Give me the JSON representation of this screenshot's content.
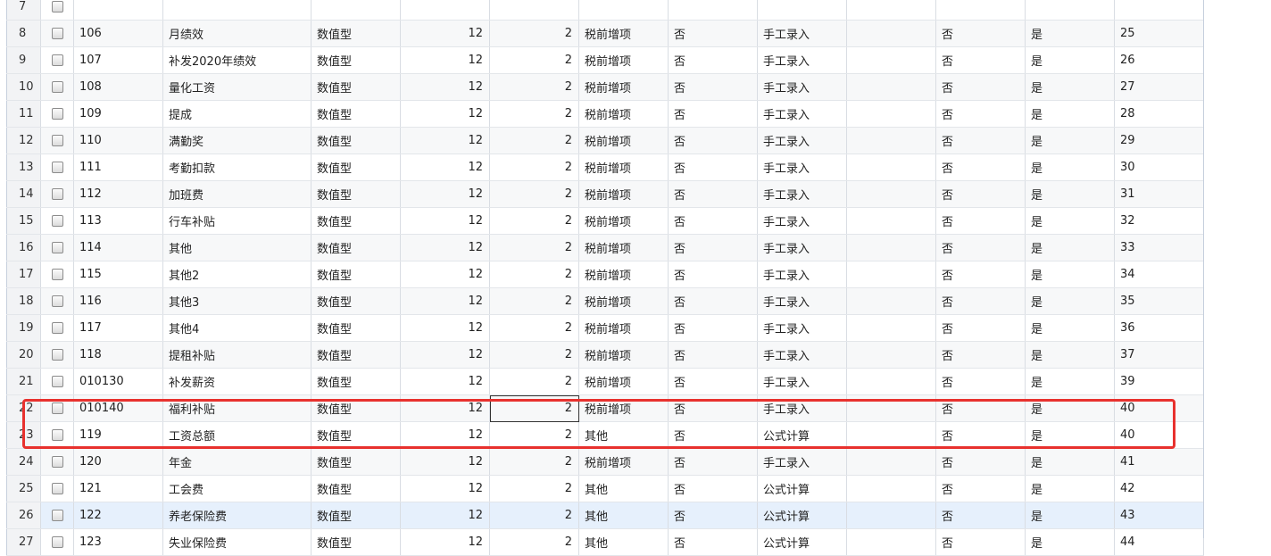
{
  "columns": [
    "row_no",
    "check",
    "code",
    "name",
    "type",
    "length",
    "decimals",
    "category",
    "tax_flag",
    "source",
    "formula",
    "flag1",
    "flag2",
    "order"
  ],
  "rows": [
    {
      "rn": "7",
      "code": "",
      "name": "",
      "type": "",
      "len": "",
      "dec": "",
      "cat": "",
      "c1": "",
      "src": "",
      "formula": "",
      "c2": "",
      "c3": "",
      "order": ""
    },
    {
      "rn": "8",
      "code": "106",
      "name": "月绩效",
      "type": "数值型",
      "len": "12",
      "dec": "2",
      "cat": "税前增项",
      "c1": "否",
      "src": "手工录入",
      "formula": "",
      "c2": "否",
      "c3": "是",
      "order": "25"
    },
    {
      "rn": "9",
      "code": "107",
      "name": "补发2020年绩效",
      "type": "数值型",
      "len": "12",
      "dec": "2",
      "cat": "税前增项",
      "c1": "否",
      "src": "手工录入",
      "formula": "",
      "c2": "否",
      "c3": "是",
      "order": "26"
    },
    {
      "rn": "10",
      "code": "108",
      "name": "量化工资",
      "type": "数值型",
      "len": "12",
      "dec": "2",
      "cat": "税前增项",
      "c1": "否",
      "src": "手工录入",
      "formula": "",
      "c2": "否",
      "c3": "是",
      "order": "27"
    },
    {
      "rn": "11",
      "code": "109",
      "name": "提成",
      "type": "数值型",
      "len": "12",
      "dec": "2",
      "cat": "税前增项",
      "c1": "否",
      "src": "手工录入",
      "formula": "",
      "c2": "否",
      "c3": "是",
      "order": "28"
    },
    {
      "rn": "12",
      "code": "110",
      "name": "满勤奖",
      "type": "数值型",
      "len": "12",
      "dec": "2",
      "cat": "税前增项",
      "c1": "否",
      "src": "手工录入",
      "formula": "",
      "c2": "否",
      "c3": "是",
      "order": "29"
    },
    {
      "rn": "13",
      "code": "111",
      "name": "考勤扣款",
      "type": "数值型",
      "len": "12",
      "dec": "2",
      "cat": "税前增项",
      "c1": "否",
      "src": "手工录入",
      "formula": "",
      "c2": "否",
      "c3": "是",
      "order": "30"
    },
    {
      "rn": "14",
      "code": "112",
      "name": "加班费",
      "type": "数值型",
      "len": "12",
      "dec": "2",
      "cat": "税前增项",
      "c1": "否",
      "src": "手工录入",
      "formula": "",
      "c2": "否",
      "c3": "是",
      "order": "31"
    },
    {
      "rn": "15",
      "code": "113",
      "name": "行车补贴",
      "type": "数值型",
      "len": "12",
      "dec": "2",
      "cat": "税前增项",
      "c1": "否",
      "src": "手工录入",
      "formula": "",
      "c2": "否",
      "c3": "是",
      "order": "32"
    },
    {
      "rn": "16",
      "code": "114",
      "name": "其他",
      "type": "数值型",
      "len": "12",
      "dec": "2",
      "cat": "税前增项",
      "c1": "否",
      "src": "手工录入",
      "formula": "",
      "c2": "否",
      "c3": "是",
      "order": "33"
    },
    {
      "rn": "17",
      "code": "115",
      "name": "其他2",
      "type": "数值型",
      "len": "12",
      "dec": "2",
      "cat": "税前增项",
      "c1": "否",
      "src": "手工录入",
      "formula": "",
      "c2": "否",
      "c3": "是",
      "order": "34"
    },
    {
      "rn": "18",
      "code": "116",
      "name": "其他3",
      "type": "数值型",
      "len": "12",
      "dec": "2",
      "cat": "税前增项",
      "c1": "否",
      "src": "手工录入",
      "formula": "",
      "c2": "否",
      "c3": "是",
      "order": "35"
    },
    {
      "rn": "19",
      "code": "117",
      "name": "其他4",
      "type": "数值型",
      "len": "12",
      "dec": "2",
      "cat": "税前增项",
      "c1": "否",
      "src": "手工录入",
      "formula": "",
      "c2": "否",
      "c3": "是",
      "order": "36"
    },
    {
      "rn": "20",
      "code": "118",
      "name": "提租补贴",
      "type": "数值型",
      "len": "12",
      "dec": "2",
      "cat": "税前增项",
      "c1": "否",
      "src": "手工录入",
      "formula": "",
      "c2": "否",
      "c3": "是",
      "order": "37"
    },
    {
      "rn": "21",
      "code": "010130",
      "name": "补发薪资",
      "type": "数值型",
      "len": "12",
      "dec": "2",
      "cat": "税前增项",
      "c1": "否",
      "src": "手工录入",
      "formula": "",
      "c2": "否",
      "c3": "是",
      "order": "39"
    },
    {
      "rn": "22",
      "code": "010140",
      "name": "福利补贴",
      "type": "数值型",
      "len": "12",
      "dec": "2",
      "cat": "税前增项",
      "c1": "否",
      "src": "手工录入",
      "formula": "",
      "c2": "否",
      "c3": "是",
      "order": "40"
    },
    {
      "rn": "23",
      "code": "119",
      "name": "工资总额",
      "type": "数值型",
      "len": "12",
      "dec": "2",
      "cat": "其他",
      "c1": "否",
      "src": "公式计算",
      "formula": "",
      "c2": "否",
      "c3": "是",
      "order": "40"
    },
    {
      "rn": "24",
      "code": "120",
      "name": "年金",
      "type": "数值型",
      "len": "12",
      "dec": "2",
      "cat": "税前增项",
      "c1": "否",
      "src": "手工录入",
      "formula": "",
      "c2": "否",
      "c3": "是",
      "order": "41"
    },
    {
      "rn": "25",
      "code": "121",
      "name": "工会费",
      "type": "数值型",
      "len": "12",
      "dec": "2",
      "cat": "其他",
      "c1": "否",
      "src": "公式计算",
      "formula": "",
      "c2": "否",
      "c3": "是",
      "order": "42"
    },
    {
      "rn": "26",
      "code": "122",
      "name": "养老保险费",
      "type": "数值型",
      "len": "12",
      "dec": "2",
      "cat": "其他",
      "c1": "否",
      "src": "公式计算",
      "formula": "",
      "c2": "否",
      "c3": "是",
      "order": "43"
    },
    {
      "rn": "27",
      "code": "123",
      "name": "失业保险费",
      "type": "数值型",
      "len": "12",
      "dec": "2",
      "cat": "其他",
      "c1": "否",
      "src": "公式计算",
      "formula": "",
      "c2": "否",
      "c3": "是",
      "order": "44"
    }
  ],
  "selected_row": "26",
  "focused_cell": {
    "row": "22",
    "field": "dec"
  },
  "highlighted_row": "23",
  "colors": {
    "highlight": "#e8312e",
    "selected_bg": "#e6f0fc"
  }
}
